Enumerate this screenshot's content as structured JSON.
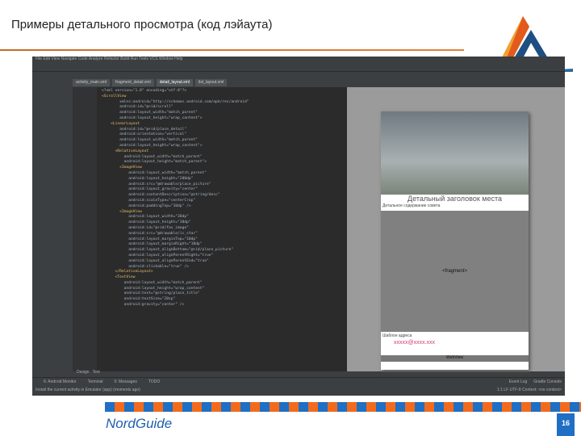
{
  "slide": {
    "title": "Примеры детального просмотра (код лэйаута)",
    "brand": "NordGuide",
    "page_number": "16"
  },
  "ide": {
    "menu": "File Edit View Navigate Code Analyze Refactor Build Run Tools VCS Window Help",
    "tabs": [
      "activity_main.xml",
      "fragment_detail.xml",
      "detail_layout.xml",
      "list_layout.xml"
    ],
    "code_lines": [
      "<?xml version=\"1.0\" encoding=\"utf-8\"?>",
      "<ScrollView",
      "        xmlns:android=\"http://schemas.android.com/apk/res/android\"",
      "        android:id=\"@+id/scroll\"",
      "        android:layout_width=\"match_parent\"",
      "        android:layout_height=\"wrap_content\">",
      "",
      "    <LinearLayout",
      "        android:id=\"@+id/place_detail\"",
      "        android:orientation=\"vertical\"",
      "        android:layout_width=\"match_parent\"",
      "        android:layout_height=\"wrap_content\">",
      "",
      "      <RelativeLayout",
      "          android:layout_width=\"match_parent\"",
      "          android:layout_height=\"match_parent\">",
      "        <ImageView",
      "            android:layout_width=\"match_parent\"",
      "            android:layout_height=\"200dp\"",
      "            android:src=\"@drawable/place_picture\"",
      "            android:layout_gravity=\"center\"",
      "            android:contentDescription=\"@string/desc\"",
      "            android:scaleType=\"centerCrop\"",
      "            android:paddingTop=\"10dp\" />",
      "        <ImageView",
      "            android:layout_width=\"30dp\"",
      "            android:layout_height=\"30dp\"",
      "            android:id=\"@+id/fav_image\"",
      "            android:src=\"@drawable/ic_star\"",
      "            android:layout_marginTop=\"10dp\"",
      "            android:layout_marginRight=\"10dp\"",
      "            android:layout_alignBottom=\"@+id/place_picture\"",
      "            android:layout_alignParentRight=\"true\"",
      "            android:layout_alignParentEnd=\"true\"",
      "            android:clickable=\"true\" />",
      "      </RelativeLayout>",
      "      <TextView",
      "          android:layout_width=\"match_parent\"",
      "          android:layout_height=\"wrap_content\"",
      "          android:text=\"@string/place_title\"",
      "          android:textSize=\"20sp\"",
      "          android:gravity=\"center\" />"
    ],
    "bottom_tabs": [
      "Design",
      "Text"
    ],
    "status_tools": [
      "6: Android Monitor",
      "Terminal",
      "0: Messages",
      "TODO"
    ],
    "status_right": [
      "Event Log",
      "Gradle Console"
    ],
    "status_message": "Install the current activity in Emulator (app) (moments ago)",
    "status_pos": "1:1  LF  UTF-8  Context: <no context>"
  },
  "preview": {
    "place_title": "Детальный заголовок места",
    "place_content": "Детальное содержание совета",
    "fragment_label": "<fragment>",
    "address_label": "Шаблон адреса",
    "email": "xxxxx@xxxx.xxx",
    "webview_label": "WebView"
  }
}
